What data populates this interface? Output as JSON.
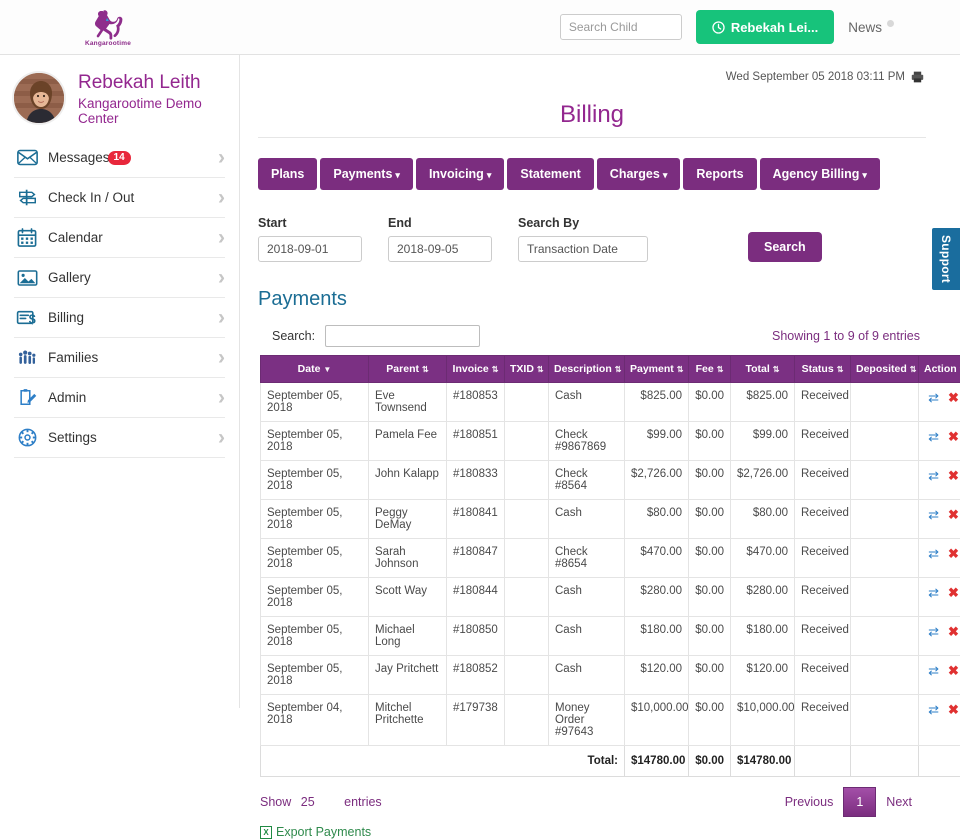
{
  "topbar": {
    "logo_text": "Kangarootime",
    "search_placeholder": "Search Child",
    "search_value": "",
    "user_button": "Rebekah Lei...",
    "news_label": "News"
  },
  "sidebar": {
    "profile": {
      "name": "Rebekah Leith",
      "org": "Kangarootime Demo Center"
    },
    "items": [
      {
        "label": "Messages",
        "icon": "envelope-icon",
        "badge": "14"
      },
      {
        "label": "Check In / Out",
        "icon": "signpost-icon",
        "badge": ""
      },
      {
        "label": "Calendar",
        "icon": "calendar-icon",
        "badge": ""
      },
      {
        "label": "Gallery",
        "icon": "image-icon",
        "badge": ""
      },
      {
        "label": "Billing",
        "icon": "invoice-dollar-icon",
        "badge": ""
      },
      {
        "label": "Families",
        "icon": "families-icon",
        "badge": ""
      },
      {
        "label": "Admin",
        "icon": "clipboard-edit-icon",
        "badge": ""
      },
      {
        "label": "Settings",
        "icon": "gear-icon",
        "badge": ""
      }
    ]
  },
  "main": {
    "datetime": "Wed September 05 2018 03:11 PM",
    "page_title": "Billing",
    "nav_buttons": [
      {
        "label": "Plans",
        "dropdown": false
      },
      {
        "label": "Payments",
        "dropdown": true
      },
      {
        "label": "Invoicing",
        "dropdown": true
      },
      {
        "label": "Statement",
        "dropdown": false
      },
      {
        "label": "Charges",
        "dropdown": true
      },
      {
        "label": "Reports",
        "dropdown": false
      },
      {
        "label": "Agency Billing",
        "dropdown": true
      }
    ],
    "filters": {
      "start_label": "Start",
      "start_value": "2018-09-01",
      "end_label": "End",
      "end_value": "2018-09-05",
      "search_by_label": "Search By",
      "search_by_value": "Transaction Date",
      "search_button": "Search"
    },
    "section_title": "Payments",
    "table_search_label": "Search:",
    "table_search_value": "",
    "entries_info": "Showing 1 to 9 of 9 entries",
    "columns": [
      "Date",
      "Parent",
      "Invoice",
      "TXID",
      "Description",
      "Payment",
      "Fee",
      "Total",
      "Status",
      "Deposited",
      "Action"
    ],
    "rows": [
      {
        "date": "September 05, 2018",
        "parent": "Eve Townsend",
        "invoice": "#180853",
        "txid": "",
        "description": "Cash",
        "payment": "$825.00",
        "fee": "$0.00",
        "total": "$825.00",
        "status": "Received",
        "deposited": ""
      },
      {
        "date": "September 05, 2018",
        "parent": "Pamela Fee",
        "invoice": "#180851",
        "txid": "",
        "description": "Check #9867869",
        "payment": "$99.00",
        "fee": "$0.00",
        "total": "$99.00",
        "status": "Received",
        "deposited": ""
      },
      {
        "date": "September 05, 2018",
        "parent": "John Kalapp",
        "invoice": "#180833",
        "txid": "",
        "description": "Check #8564",
        "payment": "$2,726.00",
        "fee": "$0.00",
        "total": "$2,726.00",
        "status": "Received",
        "deposited": ""
      },
      {
        "date": "September 05, 2018",
        "parent": "Peggy DeMay",
        "invoice": "#180841",
        "txid": "",
        "description": "Cash",
        "payment": "$80.00",
        "fee": "$0.00",
        "total": "$80.00",
        "status": "Received",
        "deposited": ""
      },
      {
        "date": "September 05, 2018",
        "parent": "Sarah Johnson",
        "invoice": "#180847",
        "txid": "",
        "description": "Check #8654",
        "payment": "$470.00",
        "fee": "$0.00",
        "total": "$470.00",
        "status": "Received",
        "deposited": ""
      },
      {
        "date": "September 05, 2018",
        "parent": "Scott Way",
        "invoice": "#180844",
        "txid": "",
        "description": "Cash",
        "payment": "$280.00",
        "fee": "$0.00",
        "total": "$280.00",
        "status": "Received",
        "deposited": ""
      },
      {
        "date": "September 05, 2018",
        "parent": "Michael Long",
        "invoice": "#180850",
        "txid": "",
        "description": "Cash",
        "payment": "$180.00",
        "fee": "$0.00",
        "total": "$180.00",
        "status": "Received",
        "deposited": ""
      },
      {
        "date": "September 05, 2018",
        "parent": "Jay Pritchett",
        "invoice": "#180852",
        "txid": "",
        "description": "Cash",
        "payment": "$120.00",
        "fee": "$0.00",
        "total": "$120.00",
        "status": "Received",
        "deposited": ""
      },
      {
        "date": "September 04, 2018",
        "parent": "Mitchel Pritchette",
        "invoice": "#179738",
        "txid": "",
        "description": "Money Order #97643",
        "payment": "$10,000.00",
        "fee": "$0.00",
        "total": "$10,000.00",
        "status": "Received",
        "deposited": ""
      }
    ],
    "totals": {
      "label": "Total:",
      "payment": "$14780.00",
      "fee": "$0.00",
      "total": "$14780.00"
    },
    "footer": {
      "show_label": "Show",
      "show_count": "25",
      "entries_label": "entries",
      "previous": "Previous",
      "page": "1",
      "next": "Next",
      "export_label": "Export Payments"
    }
  },
  "support_tab": {
    "label": "Support"
  },
  "colors": {
    "purple": "#7b2d7f",
    "header_purple": "#7b3083",
    "green": "#17c37b",
    "teal": "#1b6d94",
    "link_blue": "#2e7fc7",
    "red": "#e8273b",
    "support_blue": "#1a6d9e"
  }
}
